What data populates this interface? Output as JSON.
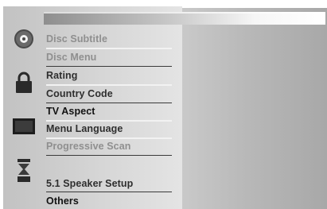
{
  "menu": {
    "disc_section": {
      "icon": "disc-icon",
      "items": [
        "Disc Subtitle",
        "Disc Menu"
      ]
    },
    "lock_section": {
      "icon": "lock-icon",
      "items": [
        "Rating",
        "Country Code"
      ]
    },
    "display_section": {
      "icon": "display-icon",
      "items": [
        "TV Aspect",
        "Menu Language",
        "Progressive Scan"
      ]
    },
    "audio_section": {
      "icon": "speaker-icon",
      "items": [
        "5.1 Speaker Setup"
      ]
    },
    "others_section": {
      "items": [
        "Others"
      ]
    }
  }
}
